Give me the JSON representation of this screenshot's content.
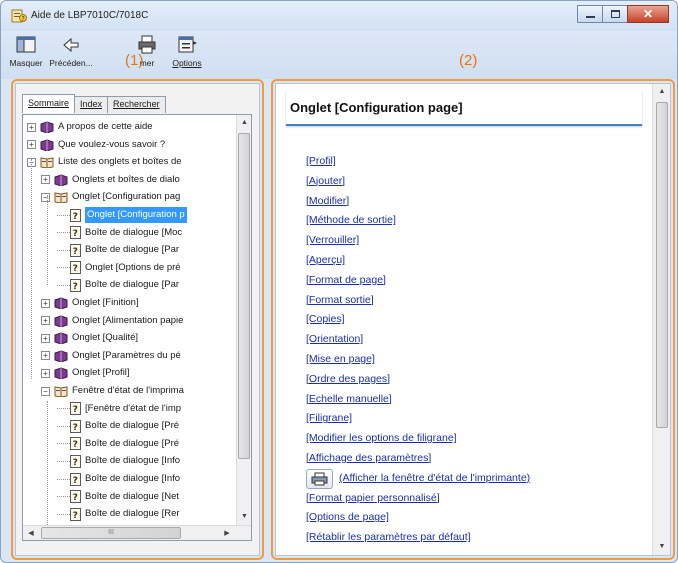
{
  "window": {
    "title": "Aide de LBP7010C/7018C",
    "close_glyph": "✕"
  },
  "toolbar": {
    "hide_label": "Masquer",
    "prev_label": "Précéden...",
    "print_label": "mer",
    "options_label": "Options",
    "icons": [
      "hide-icon",
      "back-arrow-icon",
      "print-icon",
      "options-icon"
    ]
  },
  "annotations": {
    "left": "(1)",
    "right": "(2)"
  },
  "nav": {
    "tabs": [
      {
        "label": "Sommaire",
        "active": true
      },
      {
        "label": "Index",
        "active": false
      },
      {
        "label": "Rechercher",
        "active": false
      }
    ],
    "tree": [
      {
        "label": "A propos de cette aide",
        "icon": "book-icon",
        "expander": "+"
      },
      {
        "label": "Que voulez-vous savoir ?",
        "icon": "book-icon",
        "expander": "+"
      },
      {
        "label": "Liste des onglets et boîtes de",
        "icon": "open-book-icon",
        "expander": "−"
      },
      {
        "label": "Onglets et boîtes de dialo",
        "icon": "book-icon",
        "expander": "+"
      },
      {
        "label": "Onglet [Configuration pag",
        "icon": "open-book-icon",
        "expander": "−"
      },
      {
        "label": "Onglet [Configuration p",
        "icon": "help-page-icon",
        "selected": true
      },
      {
        "label": "Boîte de dialogue [Moc",
        "icon": "help-page-icon"
      },
      {
        "label": "Boîte de dialogue [Par",
        "icon": "help-page-icon"
      },
      {
        "label": "Onglet [Options de pré",
        "icon": "help-page-icon"
      },
      {
        "label": "Boîte de dialogue [Par",
        "icon": "help-page-icon"
      },
      {
        "label": "Onglet [Finition]",
        "icon": "book-icon",
        "expander": "+"
      },
      {
        "label": "Onglet [Alimentation papie",
        "icon": "book-icon",
        "expander": "+"
      },
      {
        "label": "Onglet [Qualité]",
        "icon": "book-icon",
        "expander": "+"
      },
      {
        "label": "Onglet [Paramètres du pé",
        "icon": "book-icon",
        "expander": "+"
      },
      {
        "label": "Onglet [Profil]",
        "icon": "book-icon",
        "expander": "+"
      },
      {
        "label": "Fenêtre d'état de l'imprima",
        "icon": "open-book-icon",
        "expander": "−"
      },
      {
        "label": "[Fenêtre d'état de l'imp",
        "icon": "help-page-icon"
      },
      {
        "label": "Boîte de dialogue [Pré",
        "icon": "help-page-icon"
      },
      {
        "label": "Boîte de dialogue [Pré",
        "icon": "help-page-icon"
      },
      {
        "label": "Boîte de dialogue [Info",
        "icon": "help-page-icon"
      },
      {
        "label": "Boîte de dialogue [Info",
        "icon": "help-page-icon"
      },
      {
        "label": "Boîte de dialogue [Net",
        "icon": "help-page-icon"
      },
      {
        "label": "Boîte de dialogue [Rer",
        "icon": "help-page-icon"
      }
    ],
    "hscroll_thumb_glyph": "III"
  },
  "content": {
    "heading": "Onglet [Configuration page]",
    "links": [
      "[Profil]",
      "[Ajouter]",
      "[Modifier]",
      "[Méthode de sortie]",
      "[Verrouiller]",
      "[Aperçu]",
      "[Format de page]",
      "[Format sortie]",
      "[Copies]",
      "[Orientation]",
      "[Mise en page]",
      "[Ordre des pages]",
      "[Echelle manuelle]",
      "[Filigrane]",
      "[Modifier les options de filigrane]",
      "[Affichage des paramètres]",
      "(Afficher la fenêtre d'état de l'imprimante)",
      "[Format papier personnalisé]",
      "[Options de page]",
      "[Rétablir les paramètres par défaut]"
    ]
  },
  "colors": {
    "highlight_frame": "#f39a3c",
    "annotation_text": "#e8740c",
    "link": "#1a2fa8",
    "selection": "#3399ff"
  }
}
